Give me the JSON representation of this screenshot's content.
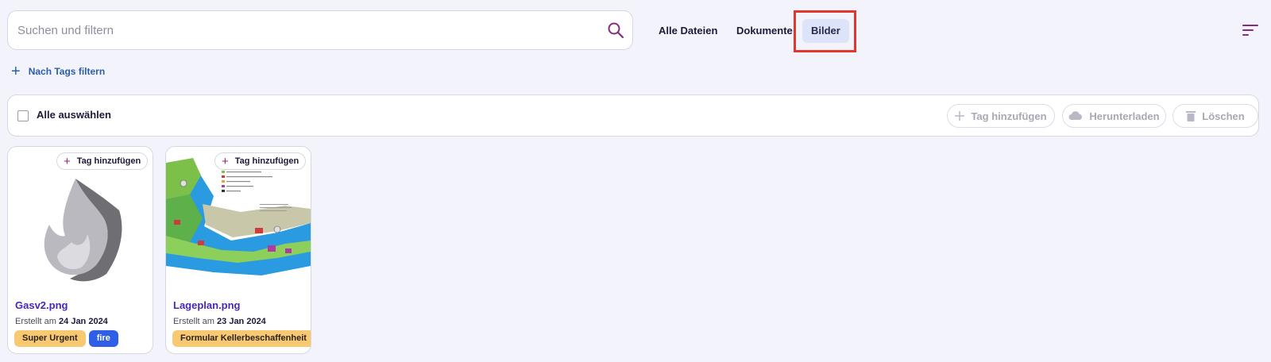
{
  "search": {
    "placeholder": "Suchen und filtern",
    "icon": "search-icon"
  },
  "tabs": [
    {
      "label": "Alle Dateien",
      "active": false
    },
    {
      "label": "Dokumente",
      "active": false
    },
    {
      "label": "Bilder",
      "active": true
    }
  ],
  "filter": {
    "tags_label": "Nach Tags filtern"
  },
  "select_bar": {
    "select_all_label": "Alle auswählen",
    "actions": [
      {
        "label": "Tag hinzufügen",
        "icon": "plus-icon"
      },
      {
        "label": "Herunterladen",
        "icon": "cloud-download-icon"
      },
      {
        "label": "Löschen",
        "icon": "trash-icon"
      }
    ]
  },
  "files": [
    {
      "name": "Gasv2.png",
      "created_prefix": "Erstellt am",
      "created_date": "24 Jan 2024",
      "add_tag_label": "Tag hinzufügen",
      "tags": [
        {
          "label": "Super Urgent",
          "color": "#f8c970"
        },
        {
          "label": "fire",
          "color": "#2e5fe6"
        }
      ]
    },
    {
      "name": "Lageplan.png",
      "created_prefix": "Erstellt am",
      "created_date": "23 Jan 2024",
      "add_tag_label": "Tag hinzufügen",
      "tags": [
        {
          "label": "Formular Kellerbeschaffenheit",
          "color": "#f8c970"
        }
      ]
    }
  ],
  "colors": {
    "accent": "#4a26b8",
    "highlight": "#e3362d",
    "link": "#2a5ea8"
  }
}
